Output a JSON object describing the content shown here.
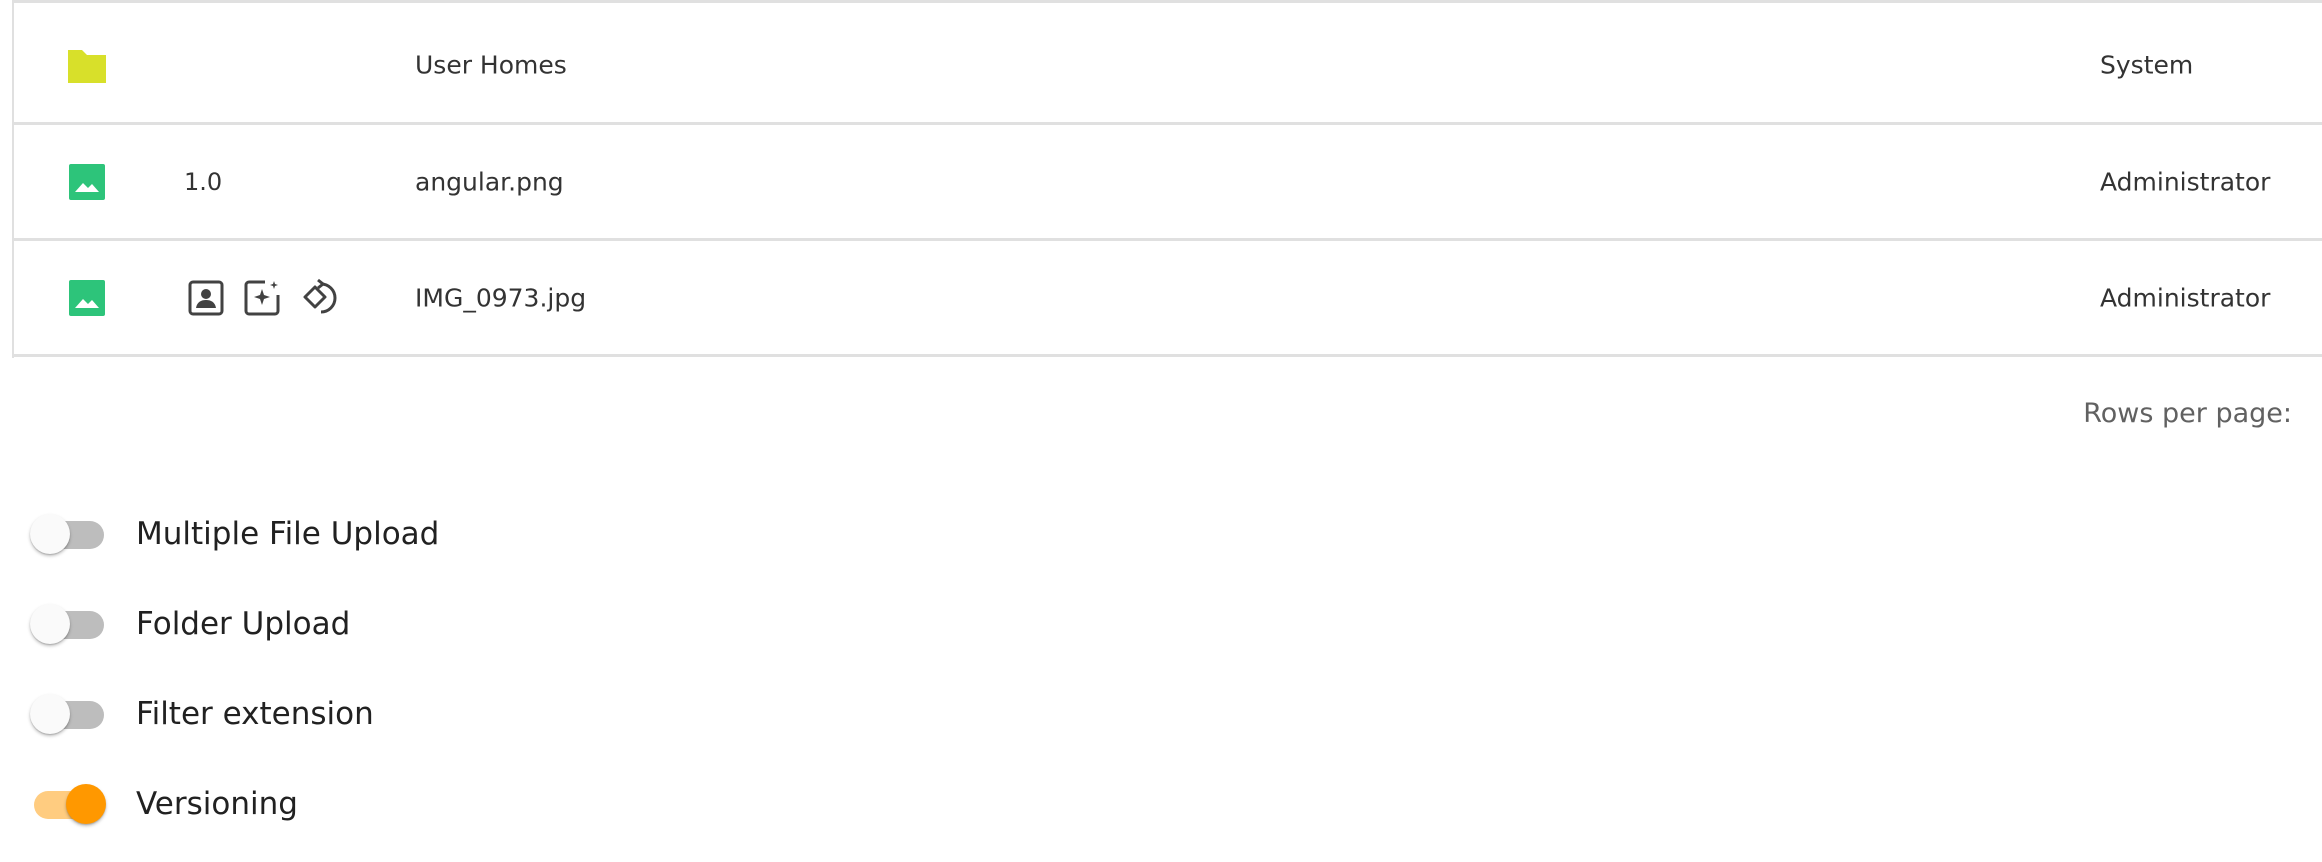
{
  "table": {
    "rows": [
      {
        "icon": "folder-icon",
        "icon_color": "#d8e02a",
        "version": "",
        "name": "User Homes",
        "owner": "System"
      },
      {
        "icon": "image-icon",
        "icon_color": "#2dc47a",
        "version": "1.0",
        "name": "angular.png",
        "owner": "Administrator"
      },
      {
        "icon": "image-icon",
        "icon_color": "#2dc47a",
        "version": "",
        "status_icons": [
          "portrait-icon",
          "auto-awesome-icon",
          "rotate-icon"
        ],
        "name": "IMG_0973.jpg",
        "owner": "Administrator"
      }
    ]
  },
  "pagination": {
    "rows_per_page_label": "Rows per page:"
  },
  "settings": {
    "toggles": [
      {
        "label": "Multiple File Upload",
        "checked": false
      },
      {
        "label": "Folder Upload",
        "checked": false
      },
      {
        "label": "Filter extension",
        "checked": false
      },
      {
        "label": "Versioning",
        "checked": true
      }
    ],
    "accent_color": "#ff9800"
  }
}
